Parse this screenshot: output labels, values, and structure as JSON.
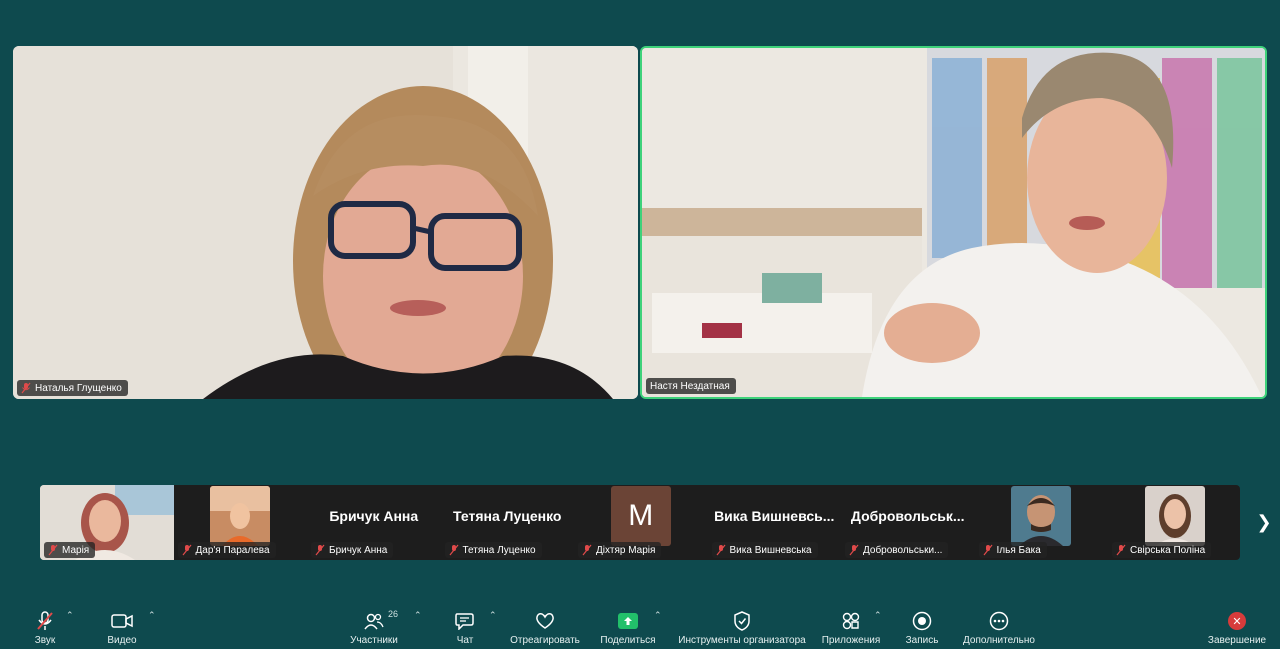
{
  "meeting": {
    "main_tiles": [
      {
        "name": "Наталья Глущенко"
      },
      {
        "name": "Настя Нездатная"
      }
    ],
    "thumbnails": [
      {
        "kind": "video",
        "label": "Марія"
      },
      {
        "kind": "image",
        "label": "Дар'я Паралева"
      },
      {
        "kind": "text",
        "display": "Бричук Анна",
        "label": "Бричук Анна"
      },
      {
        "kind": "text",
        "display": "Тетяна Луценко",
        "label": "Тетяна Луценко"
      },
      {
        "kind": "letter",
        "display": "M",
        "label": "Діхтяр Марія"
      },
      {
        "kind": "text",
        "display": "Вика  Вишневсь...",
        "label": "Вика Вишневська"
      },
      {
        "kind": "text",
        "display": "Добровольськ...",
        "label": "Добровольськи..."
      },
      {
        "kind": "image",
        "label": "Ілья Бака"
      },
      {
        "kind": "image",
        "label": "Свірська Поліна"
      }
    ]
  },
  "toolbar": {
    "audio": "Звук",
    "video": "Видео",
    "participants": "Участники",
    "participants_count": "26",
    "chat": "Чат",
    "react": "Отреагировать",
    "share": "Поделиться",
    "host_tools": "Инструменты организатора",
    "apps": "Приложения",
    "record": "Запись",
    "more": "Дополнительно",
    "end": "Завершение"
  },
  "colors": {
    "background": "#0e4a4e",
    "active_speaker_border": "#3ed27a",
    "share_green": "#22c06a",
    "end_red": "#d63b3b"
  }
}
